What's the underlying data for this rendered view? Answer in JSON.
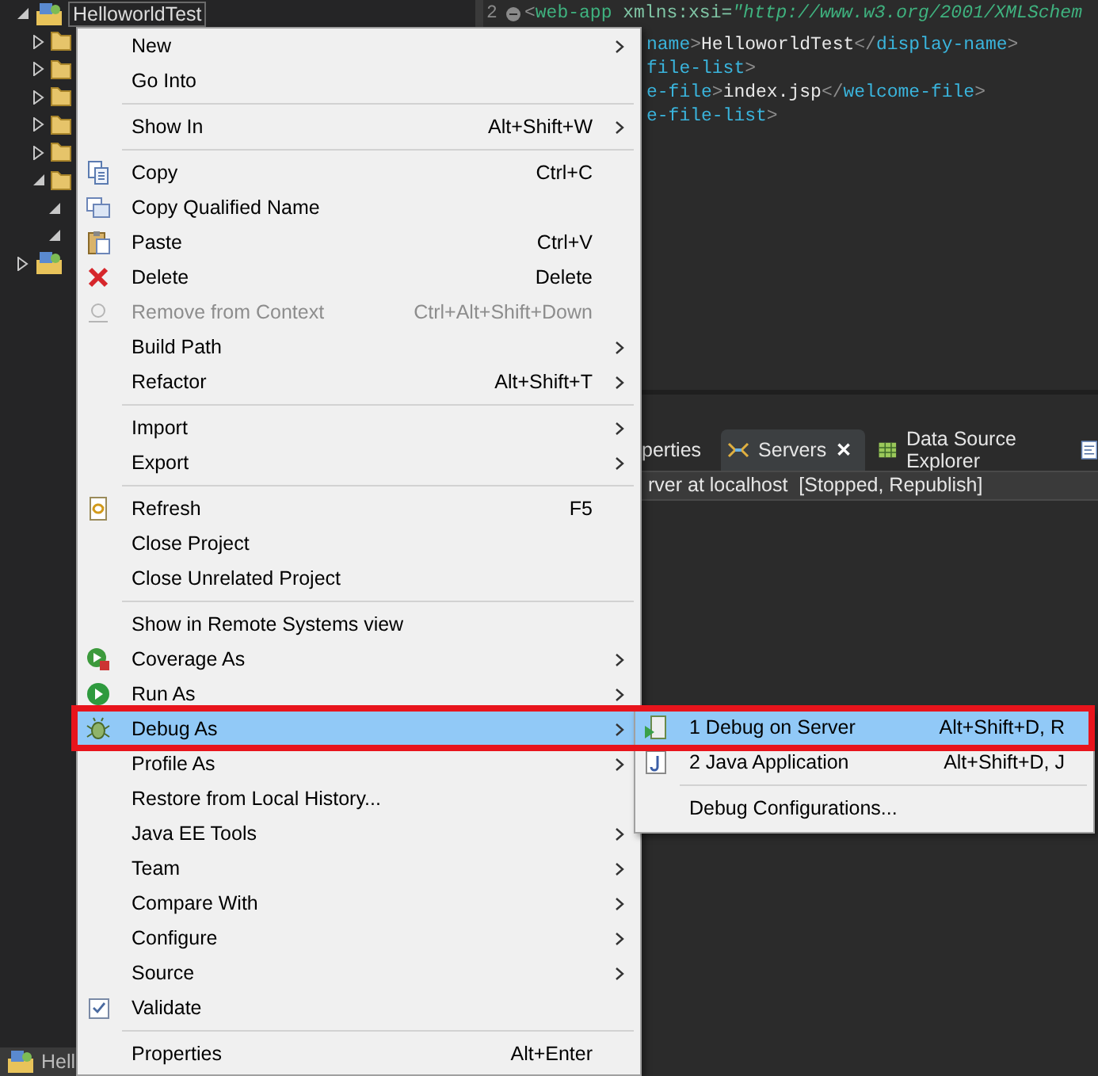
{
  "tree": [
    {
      "label": "HelloworldTest",
      "expanded": true,
      "selected": true,
      "children": [
        {
          "expanded": false
        },
        {
          "expanded": false
        },
        {
          "expanded": false
        },
        {
          "expanded": false
        },
        {
          "expanded": false
        },
        {
          "expanded": true,
          "children": [
            {
              "expanded": true
            },
            {
              "expanded": true
            }
          ]
        }
      ]
    },
    {
      "expanded": false
    }
  ],
  "editor": {
    "lines": [
      {
        "number": "2",
        "kind": "full",
        "segments": [
          {
            "kind": "bracket",
            "text": "<"
          },
          {
            "kind": "root",
            "text": "web-app"
          },
          {
            "kind": "attr",
            "text": " xmlns:xsi="
          },
          {
            "kind": "string",
            "text": "\"http://www.w3.org/2001/XMLSchem"
          }
        ]
      },
      {
        "kind": "partial",
        "segments": [
          {
            "kind": "tag",
            "text": "name"
          },
          {
            "kind": "bracket",
            "text": ">"
          },
          {
            "kind": "text",
            "text": "HelloworldTest"
          },
          {
            "kind": "bracket",
            "text": "</"
          },
          {
            "kind": "tag",
            "text": "display-name"
          },
          {
            "kind": "bracket",
            "text": ">"
          }
        ]
      },
      {
        "kind": "partial",
        "segments": [
          {
            "kind": "tag",
            "text": "file-list"
          },
          {
            "kind": "bracket",
            "text": ">"
          }
        ]
      },
      {
        "kind": "partial",
        "segments": [
          {
            "kind": "tag",
            "text": "e-file"
          },
          {
            "kind": "bracket",
            "text": ">"
          },
          {
            "kind": "text",
            "text": "index.jsp"
          },
          {
            "kind": "bracket",
            "text": "</"
          },
          {
            "kind": "tag",
            "text": "welcome-file"
          },
          {
            "kind": "bracket",
            "text": ">"
          }
        ]
      },
      {
        "kind": "partial",
        "segments": [
          {
            "kind": "tag",
            "text": "e-file-list"
          },
          {
            "kind": "bracket",
            "text": ">"
          }
        ]
      }
    ]
  },
  "bottom_panel": {
    "tabs": [
      {
        "label": "perties",
        "selected": false,
        "closable": false
      },
      {
        "label": "Servers",
        "selected": true,
        "closable": true,
        "close": "✕"
      },
      {
        "label": "Data Source Explorer",
        "selected": false,
        "closable": false
      }
    ],
    "server_row": "rver at localhost  [Stopped, Republish]"
  },
  "status_label": "Hell",
  "context_menu": [
    {
      "kind": "item",
      "label": "New",
      "submenu": true,
      "disabled": false,
      "selected": false
    },
    {
      "kind": "item",
      "label": "Go Into",
      "submenu": false,
      "disabled": false,
      "selected": false
    },
    {
      "kind": "separator"
    },
    {
      "kind": "item",
      "label": "Show In",
      "shortcut": "Alt+Shift+W",
      "submenu": true,
      "disabled": false,
      "selected": false
    },
    {
      "kind": "separator"
    },
    {
      "kind": "item",
      "label": "Copy",
      "shortcut": "Ctrl+C",
      "submenu": false,
      "disabled": false,
      "selected": false
    },
    {
      "kind": "item",
      "label": "Copy Qualified Name",
      "submenu": false,
      "disabled": false,
      "selected": false
    },
    {
      "kind": "item",
      "label": "Paste",
      "shortcut": "Ctrl+V",
      "submenu": false,
      "disabled": false,
      "selected": false
    },
    {
      "kind": "item",
      "label": "Delete",
      "shortcut": "Delete",
      "submenu": false,
      "disabled": false,
      "selected": false
    },
    {
      "kind": "item",
      "label": "Remove from Context",
      "shortcut": "Ctrl+Alt+Shift+Down",
      "submenu": false,
      "disabled": true,
      "selected": false
    },
    {
      "kind": "item",
      "label": "Build Path",
      "submenu": true,
      "disabled": false,
      "selected": false
    },
    {
      "kind": "item",
      "label": "Refactor",
      "shortcut": "Alt+Shift+T",
      "submenu": true,
      "disabled": false,
      "selected": false
    },
    {
      "kind": "separator"
    },
    {
      "kind": "item",
      "label": "Import",
      "submenu": true,
      "disabled": false,
      "selected": false
    },
    {
      "kind": "item",
      "label": "Export",
      "submenu": true,
      "disabled": false,
      "selected": false
    },
    {
      "kind": "separator"
    },
    {
      "kind": "item",
      "label": "Refresh",
      "shortcut": "F5",
      "submenu": false,
      "disabled": false,
      "selected": false
    },
    {
      "kind": "item",
      "label": "Close Project",
      "submenu": false,
      "disabled": false,
      "selected": false
    },
    {
      "kind": "item",
      "label": "Close Unrelated Project",
      "submenu": false,
      "disabled": false,
      "selected": false
    },
    {
      "kind": "separator"
    },
    {
      "kind": "item",
      "label": "Show in Remote Systems view",
      "submenu": false,
      "disabled": false,
      "selected": false
    },
    {
      "kind": "item",
      "label": "Coverage As",
      "submenu": true,
      "disabled": false,
      "selected": false
    },
    {
      "kind": "item",
      "label": "Run As",
      "submenu": true,
      "disabled": false,
      "selected": false
    },
    {
      "kind": "item",
      "label": "Debug As",
      "submenu": true,
      "disabled": false,
      "selected": true
    },
    {
      "kind": "item",
      "label": "Profile As",
      "submenu": true,
      "disabled": false,
      "selected": false
    },
    {
      "kind": "item",
      "label": "Restore from Local History...",
      "submenu": false,
      "disabled": false,
      "selected": false
    },
    {
      "kind": "item",
      "label": "Java EE Tools",
      "submenu": true,
      "disabled": false,
      "selected": false
    },
    {
      "kind": "item",
      "label": "Team",
      "submenu": true,
      "disabled": false,
      "selected": false
    },
    {
      "kind": "item",
      "label": "Compare With",
      "submenu": true,
      "disabled": false,
      "selected": false
    },
    {
      "kind": "item",
      "label": "Configure",
      "submenu": true,
      "disabled": false,
      "selected": false
    },
    {
      "kind": "item",
      "label": "Source",
      "submenu": true,
      "disabled": false,
      "selected": false
    },
    {
      "kind": "check",
      "label": "Validate",
      "checked": true,
      "submenu": false,
      "disabled": false,
      "selected": false
    },
    {
      "kind": "separator"
    },
    {
      "kind": "item",
      "label": "Properties",
      "shortcut": "Alt+Enter",
      "submenu": false,
      "disabled": false,
      "selected": false
    }
  ],
  "submenu": [
    {
      "kind": "item",
      "label": "1 Debug on Server",
      "shortcut": "Alt+Shift+D, R",
      "selected": true
    },
    {
      "kind": "item",
      "label": "2 Java Application",
      "shortcut": "Alt+Shift+D, J",
      "selected": false
    },
    {
      "kind": "separator"
    },
    {
      "kind": "item",
      "label": "Debug Configurations...",
      "selected": false
    }
  ],
  "highlight_frame": {
    "color": "#e8141c"
  }
}
